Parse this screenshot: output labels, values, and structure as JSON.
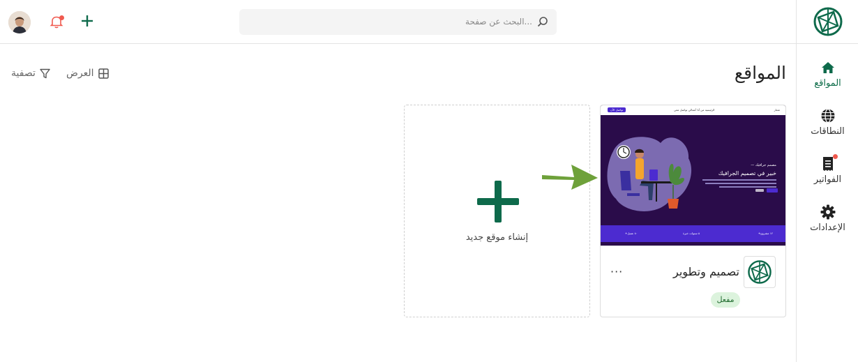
{
  "header": {
    "search_placeholder": "البحث عن صفحة..."
  },
  "sidebar": {
    "items": [
      {
        "label": "المواقع",
        "icon": "home-icon",
        "active": true
      },
      {
        "label": "النطاقات",
        "icon": "globe-icon",
        "active": false
      },
      {
        "label": "الفواتير",
        "icon": "receipt-icon",
        "active": false,
        "notification": true
      },
      {
        "label": "الإعدادات",
        "icon": "gear-icon",
        "active": false
      }
    ]
  },
  "main": {
    "title": "المواقع",
    "view_label": "العرض",
    "filter_label": "تصفية",
    "new_site_label": "إنشاء موقع جديد",
    "site": {
      "name": "تصميم وتطوير",
      "status": "مفعل",
      "preview": {
        "nav_links": "الرئيسية  من أنا  أعمالي  تواصل معي",
        "nav_button": "تواصل الآن",
        "brand": "شعار",
        "subtitle": "— مصمم جرافيك",
        "headline": "خبير في تصميم الجرافيك",
        "stats": [
          "+١٢ مشروع",
          "٥ سنوات خبرة",
          "+٨٠ عميل"
        ]
      }
    }
  },
  "colors": {
    "brand": "#0e6a4b",
    "notification": "#f05a4f",
    "preview_bg": "#2a0c4a",
    "preview_accent": "#4c2bd0",
    "arrow": "#6ea13a"
  }
}
